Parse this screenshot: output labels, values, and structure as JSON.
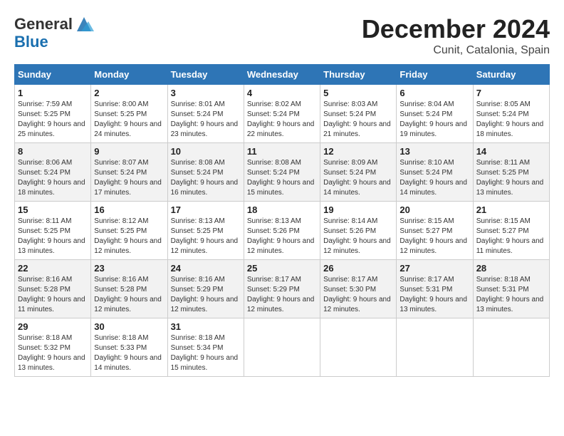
{
  "header": {
    "logo_general": "General",
    "logo_blue": "Blue",
    "month": "December 2024",
    "location": "Cunit, Catalonia, Spain"
  },
  "weekdays": [
    "Sunday",
    "Monday",
    "Tuesday",
    "Wednesday",
    "Thursday",
    "Friday",
    "Saturday"
  ],
  "weeks": [
    [
      {
        "day": "1",
        "sunrise": "7:59 AM",
        "sunset": "5:25 PM",
        "daylight": "9 hours and 25 minutes."
      },
      {
        "day": "2",
        "sunrise": "8:00 AM",
        "sunset": "5:25 PM",
        "daylight": "9 hours and 24 minutes."
      },
      {
        "day": "3",
        "sunrise": "8:01 AM",
        "sunset": "5:24 PM",
        "daylight": "9 hours and 23 minutes."
      },
      {
        "day": "4",
        "sunrise": "8:02 AM",
        "sunset": "5:24 PM",
        "daylight": "9 hours and 22 minutes."
      },
      {
        "day": "5",
        "sunrise": "8:03 AM",
        "sunset": "5:24 PM",
        "daylight": "9 hours and 21 minutes."
      },
      {
        "day": "6",
        "sunrise": "8:04 AM",
        "sunset": "5:24 PM",
        "daylight": "9 hours and 19 minutes."
      },
      {
        "day": "7",
        "sunrise": "8:05 AM",
        "sunset": "5:24 PM",
        "daylight": "9 hours and 18 minutes."
      }
    ],
    [
      {
        "day": "8",
        "sunrise": "8:06 AM",
        "sunset": "5:24 PM",
        "daylight": "9 hours and 18 minutes."
      },
      {
        "day": "9",
        "sunrise": "8:07 AM",
        "sunset": "5:24 PM",
        "daylight": "9 hours and 17 minutes."
      },
      {
        "day": "10",
        "sunrise": "8:08 AM",
        "sunset": "5:24 PM",
        "daylight": "9 hours and 16 minutes."
      },
      {
        "day": "11",
        "sunrise": "8:08 AM",
        "sunset": "5:24 PM",
        "daylight": "9 hours and 15 minutes."
      },
      {
        "day": "12",
        "sunrise": "8:09 AM",
        "sunset": "5:24 PM",
        "daylight": "9 hours and 14 minutes."
      },
      {
        "day": "13",
        "sunrise": "8:10 AM",
        "sunset": "5:24 PM",
        "daylight": "9 hours and 14 minutes."
      },
      {
        "day": "14",
        "sunrise": "8:11 AM",
        "sunset": "5:25 PM",
        "daylight": "9 hours and 13 minutes."
      }
    ],
    [
      {
        "day": "15",
        "sunrise": "8:11 AM",
        "sunset": "5:25 PM",
        "daylight": "9 hours and 13 minutes."
      },
      {
        "day": "16",
        "sunrise": "8:12 AM",
        "sunset": "5:25 PM",
        "daylight": "9 hours and 12 minutes."
      },
      {
        "day": "17",
        "sunrise": "8:13 AM",
        "sunset": "5:25 PM",
        "daylight": "9 hours and 12 minutes."
      },
      {
        "day": "18",
        "sunrise": "8:13 AM",
        "sunset": "5:26 PM",
        "daylight": "9 hours and 12 minutes."
      },
      {
        "day": "19",
        "sunrise": "8:14 AM",
        "sunset": "5:26 PM",
        "daylight": "9 hours and 12 minutes."
      },
      {
        "day": "20",
        "sunrise": "8:15 AM",
        "sunset": "5:27 PM",
        "daylight": "9 hours and 12 minutes."
      },
      {
        "day": "21",
        "sunrise": "8:15 AM",
        "sunset": "5:27 PM",
        "daylight": "9 hours and 11 minutes."
      }
    ],
    [
      {
        "day": "22",
        "sunrise": "8:16 AM",
        "sunset": "5:28 PM",
        "daylight": "9 hours and 11 minutes."
      },
      {
        "day": "23",
        "sunrise": "8:16 AM",
        "sunset": "5:28 PM",
        "daylight": "9 hours and 12 minutes."
      },
      {
        "day": "24",
        "sunrise": "8:16 AM",
        "sunset": "5:29 PM",
        "daylight": "9 hours and 12 minutes."
      },
      {
        "day": "25",
        "sunrise": "8:17 AM",
        "sunset": "5:29 PM",
        "daylight": "9 hours and 12 minutes."
      },
      {
        "day": "26",
        "sunrise": "8:17 AM",
        "sunset": "5:30 PM",
        "daylight": "9 hours and 12 minutes."
      },
      {
        "day": "27",
        "sunrise": "8:17 AM",
        "sunset": "5:31 PM",
        "daylight": "9 hours and 13 minutes."
      },
      {
        "day": "28",
        "sunrise": "8:18 AM",
        "sunset": "5:31 PM",
        "daylight": "9 hours and 13 minutes."
      }
    ],
    [
      {
        "day": "29",
        "sunrise": "8:18 AM",
        "sunset": "5:32 PM",
        "daylight": "9 hours and 13 minutes."
      },
      {
        "day": "30",
        "sunrise": "8:18 AM",
        "sunset": "5:33 PM",
        "daylight": "9 hours and 14 minutes."
      },
      {
        "day": "31",
        "sunrise": "8:18 AM",
        "sunset": "5:34 PM",
        "daylight": "9 hours and 15 minutes."
      },
      null,
      null,
      null,
      null
    ]
  ]
}
